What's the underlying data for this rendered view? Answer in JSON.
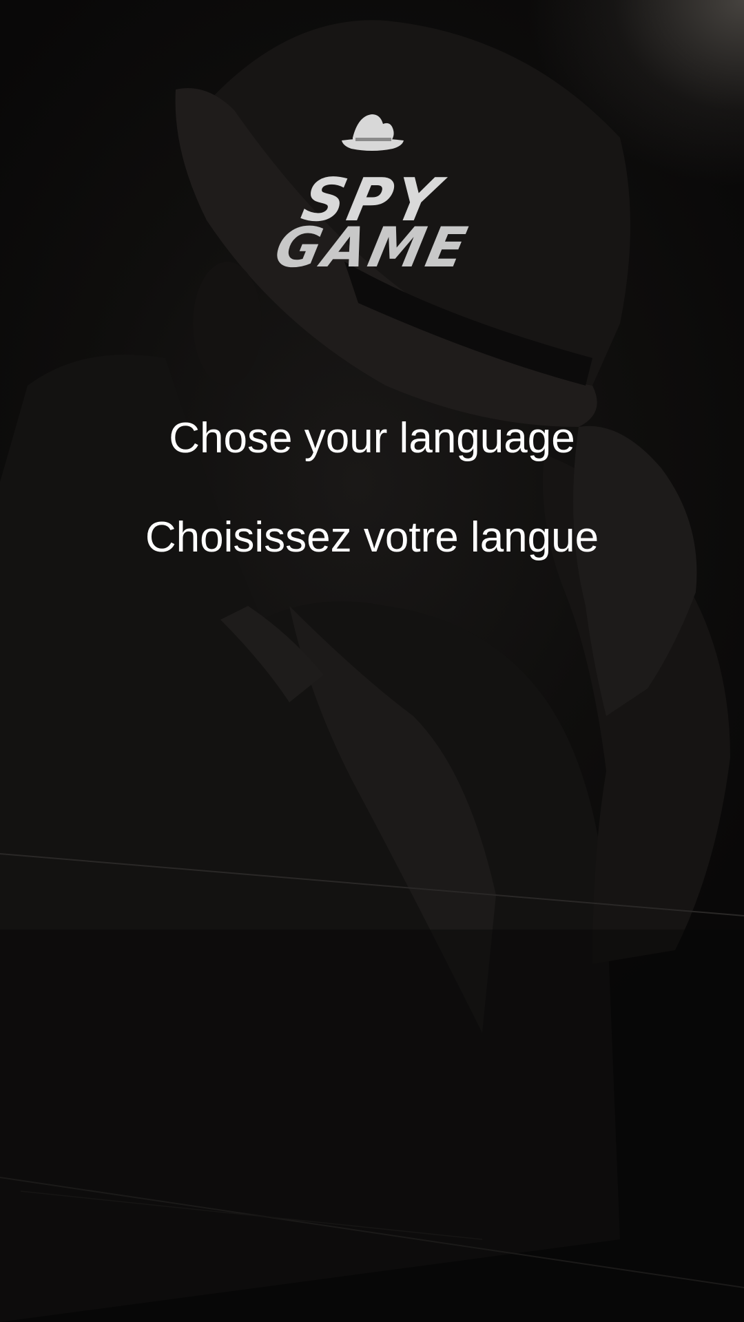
{
  "app": {
    "logo_line1": "SPY",
    "logo_line2": "GAME",
    "logo_icon": "spy-hat-icon"
  },
  "languages": [
    {
      "label": "Chose your language"
    },
    {
      "label": "Choisissez votre langue"
    }
  ],
  "colors": {
    "background": "#0b0a0a",
    "text": "#ffffff",
    "logo": "#d9d9d9"
  }
}
